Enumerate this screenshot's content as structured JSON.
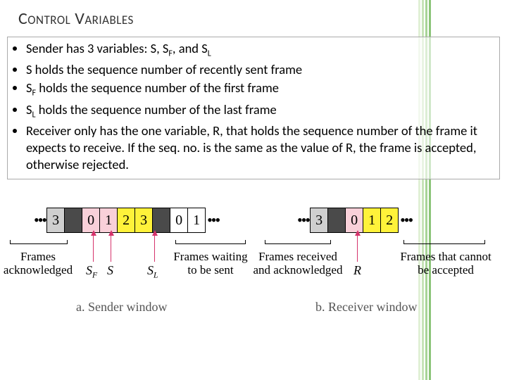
{
  "title": "Control Variables",
  "bullets": [
    {
      "pre": "Sender has 3 variables: S, S",
      "sub1": "F",
      "mid": ", and S",
      "sub2": "L",
      "post": ""
    },
    {
      "pre": "S holds the sequence number of recently sent frame",
      "sub1": "",
      "mid": "",
      "sub2": "",
      "post": ""
    },
    {
      "pre": "S",
      "sub1": "F",
      "mid": " holds the sequence number of the first frame",
      "sub2": "",
      "post": ""
    },
    {
      "pre": "S",
      "sub1": "L",
      "mid": " holds the sequence number of the last frame",
      "sub2": "",
      "post": ""
    },
    {
      "pre": "Receiver only has the one variable, R, that holds the sequence number of the frame it expects to receive. If the seq. no. is the same as the value of R, the frame is accepted, otherwise rejected.",
      "sub1": "",
      "mid": "",
      "sub2": "",
      "post": ""
    }
  ],
  "figure": {
    "sender": {
      "cells": [
        "3",
        "0",
        "1",
        "2",
        "3",
        "0",
        "1"
      ],
      "ellipsis": "•••",
      "arrows": {
        "SF": "S",
        "SFsub": "F",
        "S": "S",
        "SL": "S",
        "SLsub": "L"
      },
      "brackets": {
        "left": "Frames\nacknowledged",
        "right": "Frames waiting\nto be sent"
      },
      "caption": "a. Sender window"
    },
    "receiver": {
      "cells": [
        "3",
        "0",
        "1",
        "2"
      ],
      "ellipsis": "•••",
      "arrows": {
        "R": "R"
      },
      "brackets": {
        "left": "Frames received\nand acknowledged",
        "right": "Frames that cannot\nbe accepted"
      },
      "caption": "b. Receiver window"
    }
  }
}
